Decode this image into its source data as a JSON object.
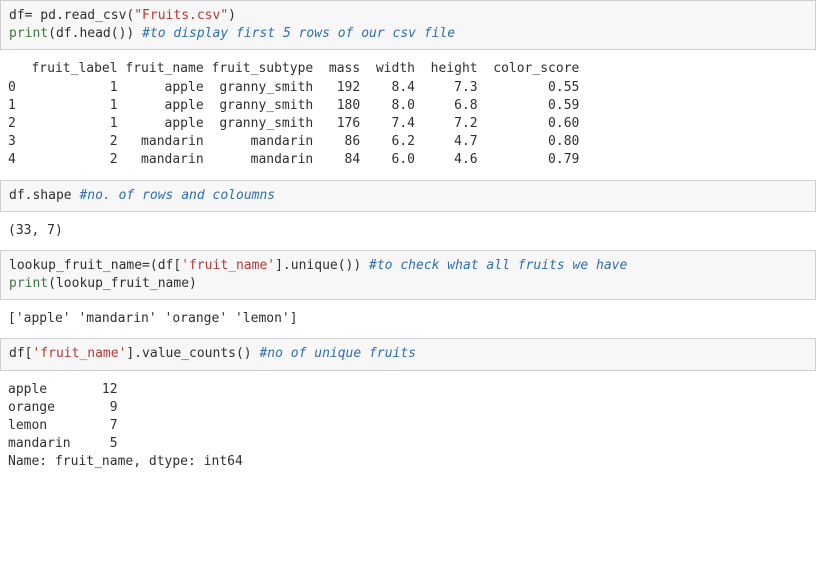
{
  "cell1": {
    "code": {
      "pre1": "df= pd.read_csv(",
      "str1": "\"Fruits.csv\"",
      "pre2": ")\n",
      "func1": "print",
      "pre3": "(df.head()) ",
      "cmt1": "#to display first 5 rows of our csv file"
    },
    "output": "   fruit_label fruit_name fruit_subtype  mass  width  height  color_score\n0            1      apple  granny_smith   192    8.4     7.3         0.55\n1            1      apple  granny_smith   180    8.0     6.8         0.59\n2            1      apple  granny_smith   176    7.4     7.2         0.60\n3            2   mandarin      mandarin    86    6.2     4.7         0.80\n4            2   mandarin      mandarin    84    6.0     4.6         0.79"
  },
  "cell2": {
    "code": {
      "pre1": "df.shape ",
      "cmt1": "#no. of rows and coloumns"
    },
    "output": "(33, 7)"
  },
  "cell3": {
    "code": {
      "pre1": "lookup_fruit_name=(df[",
      "str1": "'fruit_name'",
      "pre2": "].unique()) ",
      "cmt1": "#to check what all fruits we have",
      "newline": "\n",
      "func1": "print",
      "pre3": "(lookup_fruit_name)"
    },
    "output": "['apple' 'mandarin' 'orange' 'lemon']"
  },
  "cell4": {
    "code": {
      "pre1": "df[",
      "str1": "'fruit_name'",
      "pre2": "].value_counts() ",
      "cmt1": "#no of unique fruits"
    },
    "output": "apple       12\norange       9\nlemon        7\nmandarin     5\nName: fruit_name, dtype: int64"
  },
  "chart_data": {
    "type": "table",
    "title": "df.head()",
    "columns": [
      "fruit_label",
      "fruit_name",
      "fruit_subtype",
      "mass",
      "width",
      "height",
      "color_score"
    ],
    "rows": [
      [
        1,
        "apple",
        "granny_smith",
        192,
        8.4,
        7.3,
        0.55
      ],
      [
        1,
        "apple",
        "granny_smith",
        180,
        8.0,
        6.8,
        0.59
      ],
      [
        1,
        "apple",
        "granny_smith",
        176,
        7.4,
        7.2,
        0.6
      ],
      [
        2,
        "mandarin",
        "mandarin",
        86,
        6.2,
        4.7,
        0.8
      ],
      [
        2,
        "mandarin",
        "mandarin",
        84,
        6.0,
        4.6,
        0.79
      ]
    ],
    "shape": [
      33,
      7
    ],
    "unique_fruits": [
      "apple",
      "mandarin",
      "orange",
      "lemon"
    ],
    "value_counts": {
      "apple": 12,
      "orange": 9,
      "lemon": 7,
      "mandarin": 5
    }
  }
}
